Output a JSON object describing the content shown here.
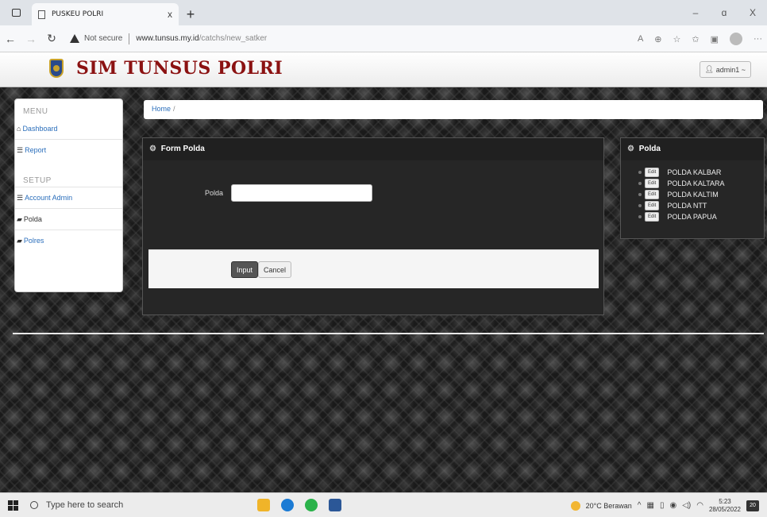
{
  "browser": {
    "tab_title": "PUSKEU POLRI",
    "tab_close": "x",
    "new_tab": "+",
    "win_minimize": "–",
    "win_restore": "ɑ",
    "win_close": "X",
    "security_label": "Not secure",
    "url_host": "www.tunsus.my.id",
    "url_path": "/catchs/new_satker"
  },
  "header": {
    "brand": "SIM TUNSUS POLRI",
    "user_menu": "admin1 ~"
  },
  "sidebar": {
    "menu_heading": "MENU",
    "setup_heading": "SETUP",
    "items": [
      {
        "label": "Dashboard",
        "icon": "home-icon"
      },
      {
        "label": "Report",
        "icon": "list-icon"
      },
      {
        "label": "Account Admin",
        "icon": "list-icon"
      },
      {
        "label": "Polda",
        "icon": "comment-icon"
      },
      {
        "label": "Polres",
        "icon": "comment-icon"
      }
    ]
  },
  "breadcrumb": {
    "home": "Home",
    "divider": "/"
  },
  "form_panel": {
    "title": "Form Polda",
    "field_label": "Polda",
    "field_value": "",
    "input_button": "Input",
    "cancel_button": "Cancel"
  },
  "list_panel": {
    "title": "Polda",
    "edit_label": "Edit",
    "items": [
      "POLDA KALBAR",
      "POLDA KALTARA",
      "POLDA KALTIM",
      "POLDA NTT",
      "POLDA PAPUA"
    ]
  },
  "taskbar": {
    "search_placeholder": "Type here to search",
    "weather": "20°C Berawan",
    "time": "5:23",
    "date": "28/05/2022",
    "notifications": "20"
  },
  "colors": {
    "brand": "#8b1212",
    "link": "#2a6ebb",
    "panel_bg": "#262626"
  }
}
